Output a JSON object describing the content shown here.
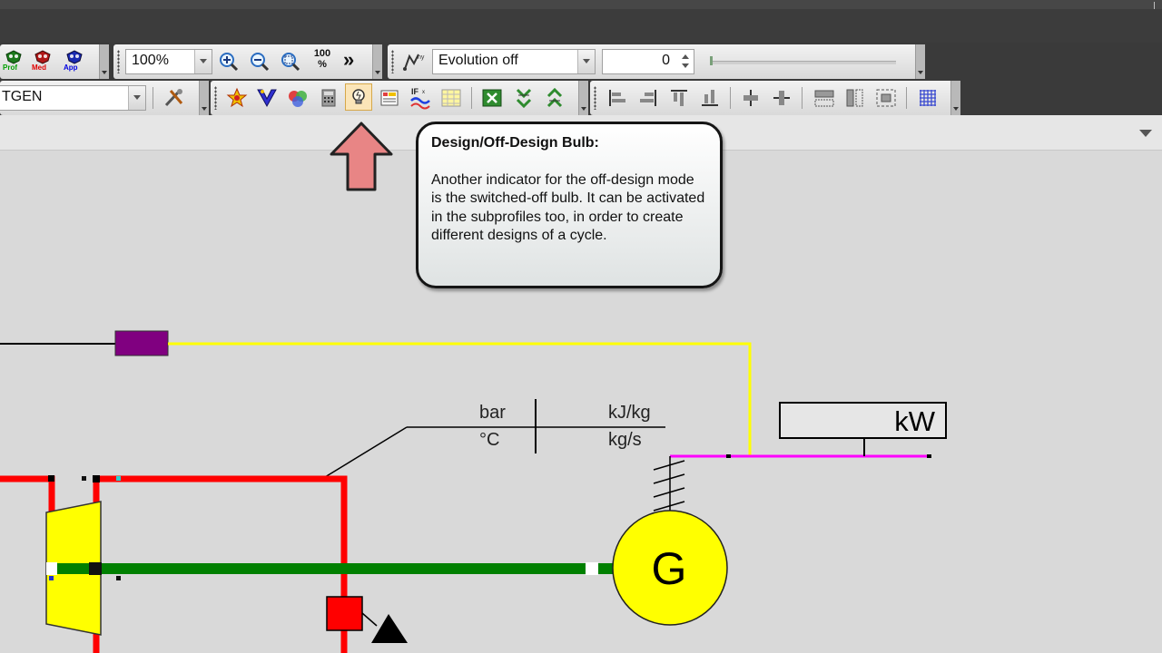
{
  "toolbar": {
    "mini_buttons": [
      {
        "label": "Prof",
        "color": "#00a000"
      },
      {
        "label": "Med",
        "color": "#e00000"
      },
      {
        "label": "App",
        "color": "#0000e0"
      }
    ],
    "zoom_value": "100%",
    "zoom_100_label": "100\n%",
    "more_label": "»",
    "evolution_value": "Evolution off",
    "evolution_step": "0",
    "profile_value": "TGEN"
  },
  "callout": {
    "title": "Design/Off-Design Bulb:",
    "body": "Another indicator for the off-design mode is the switched-off bulb. It can be activated in the subprofiles too, in order to create different designs of a cycle."
  },
  "diagram": {
    "value_box_units": {
      "top_left": "bar",
      "top_right": "kJ/kg",
      "bottom_left": "°C",
      "bottom_right": "kg/s"
    },
    "power_unit": "kW",
    "generator_label": "G",
    "colors": {
      "live_steam": "#ff0000",
      "shaft": "#008000",
      "signal": "#ffff00",
      "electric": "#ff00ff",
      "turbine": "#ffff00",
      "controller": "#800080",
      "arrow": "#e88585"
    }
  }
}
